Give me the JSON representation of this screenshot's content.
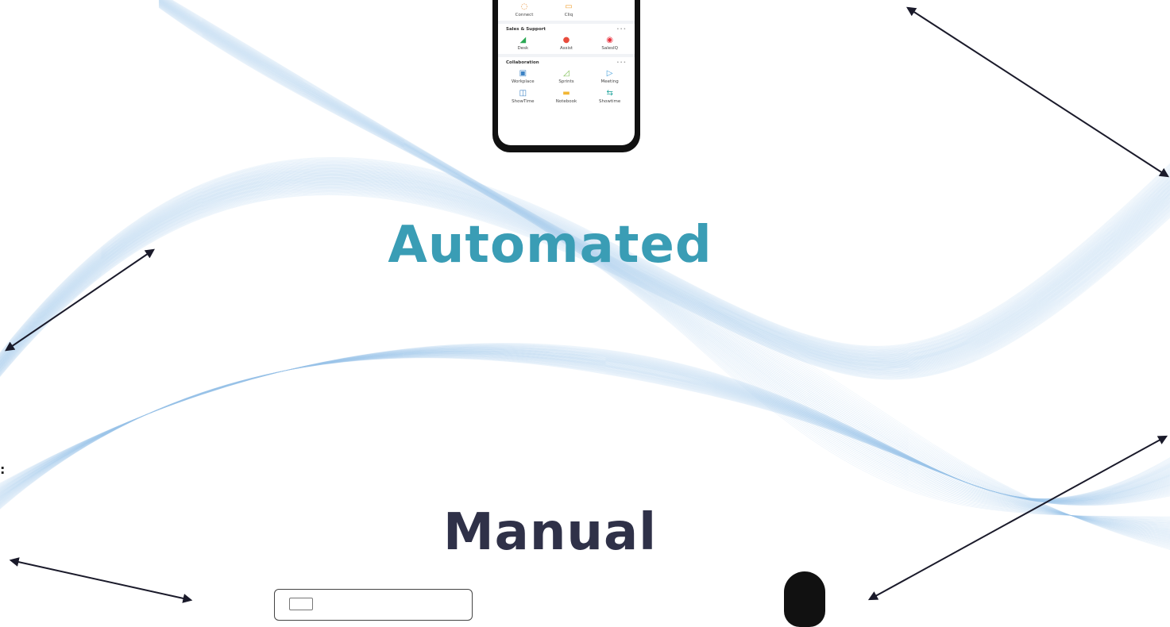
{
  "phone": {
    "top_apps": [
      {
        "label": "Connect",
        "icon": "chat-icon",
        "color": "#e58a2f"
      },
      {
        "label": "Cliq",
        "icon": "cliq-icon",
        "color": "#f0a136"
      }
    ],
    "sections": [
      {
        "title": "Sales & Support",
        "more": "•••",
        "apps": [
          {
            "label": "Desk",
            "icon": "desk-icon",
            "color": "#2aa853"
          },
          {
            "label": "Assist",
            "icon": "assist-icon",
            "color": "#e84c3d"
          },
          {
            "label": "SalesIQ",
            "icon": "salesiq-icon",
            "color": "#e8313d"
          }
        ]
      },
      {
        "title": "Collaboration",
        "more": "•••",
        "apps": [
          {
            "label": "Workplace",
            "icon": "workplace-icon",
            "color": "#3b82c4"
          },
          {
            "label": "Sprints",
            "icon": "sprints-icon",
            "color": "#7bbd4f"
          },
          {
            "label": "Meeting",
            "icon": "meeting-icon",
            "color": "#3d9bd9"
          },
          {
            "label": "ShowTime",
            "icon": "showtime-icon",
            "color": "#3b82c4"
          },
          {
            "label": "Notebook",
            "icon": "notebook-icon",
            "color": "#f2b634"
          },
          {
            "label": "Showtime",
            "icon": "share-icon",
            "color": "#2aa8a0"
          }
        ]
      }
    ]
  },
  "headings": {
    "automated": "Automated",
    "manual": "Manual"
  },
  "colors": {
    "automated": "#3a9db5",
    "manual": "#2f3148",
    "wave": "#9cc5ea"
  }
}
